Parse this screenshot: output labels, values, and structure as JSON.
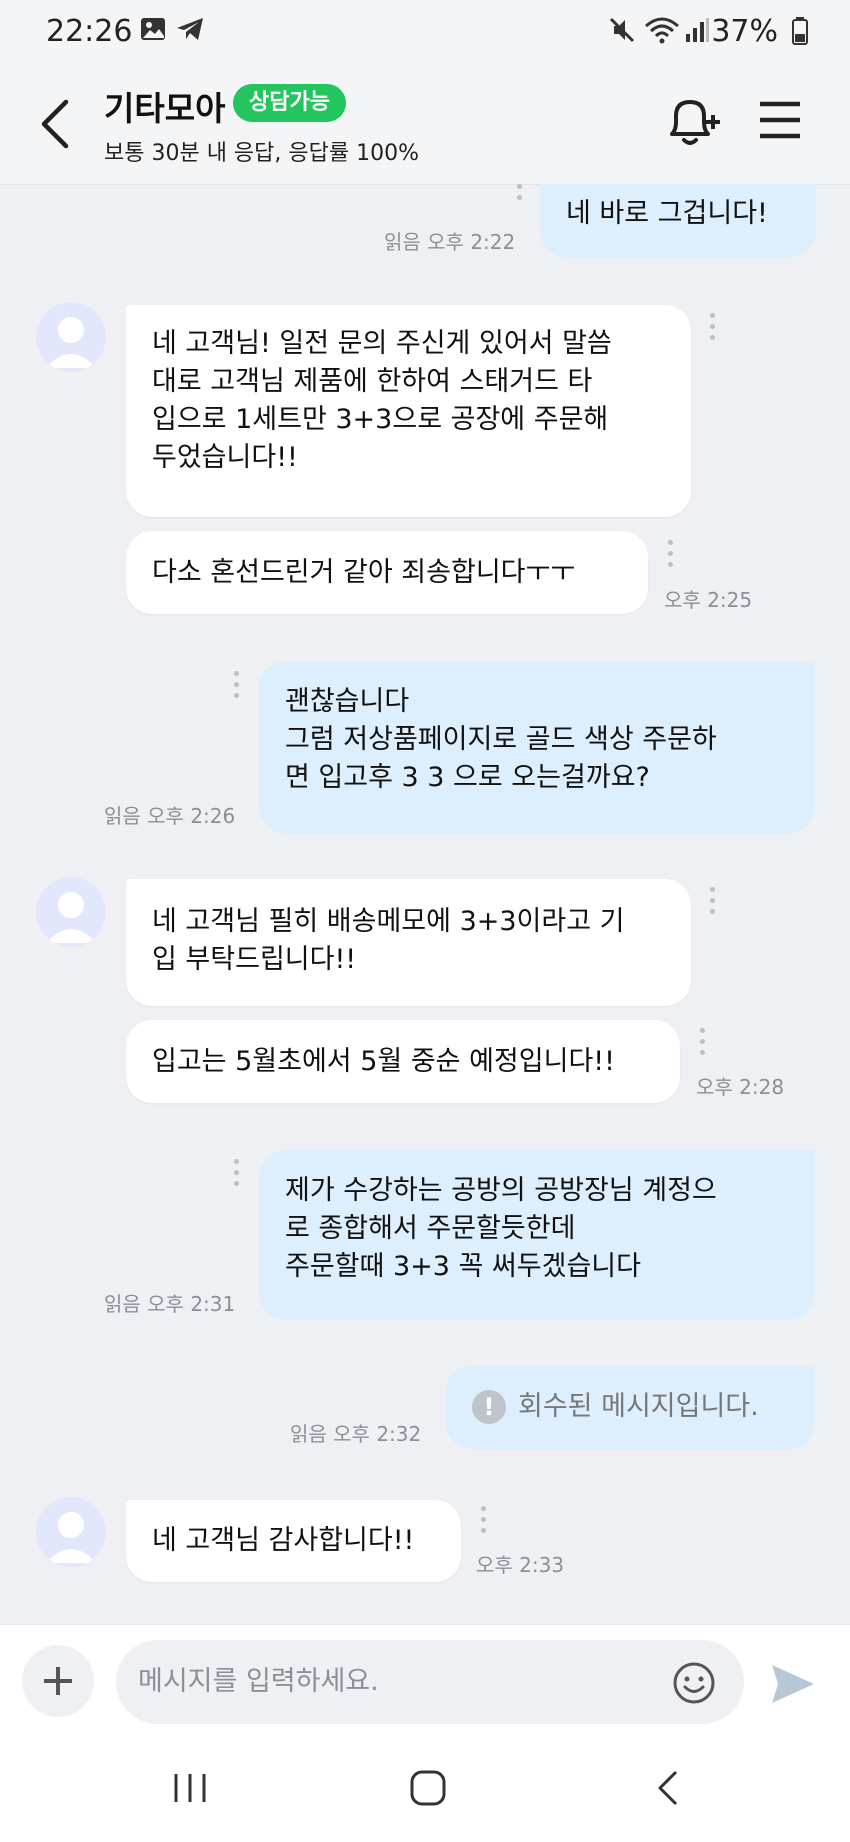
{
  "status_bar": {
    "time": "22:26",
    "battery": "37%",
    "icons": [
      "gallery-icon",
      "telegram-icon",
      "mute-icon",
      "wifi-icon",
      "signal-icon",
      "battery-icon"
    ]
  },
  "header": {
    "title": "기타모아",
    "badge": "상담가능",
    "subtitle": "보통 30분 내 응답, 응답률 100%",
    "badge_color": "#22c55e"
  },
  "messages": [
    {
      "dir": "out",
      "text": "네 바로 그겁니다!",
      "meta": "읽음 오후 2:22"
    },
    {
      "dir": "in",
      "text": "네 고객님! 일전 문의 주신게 있어서 말씀\n대로 고객님 제품에 한하여 스태거드 타\n입으로 1세트만 3+3으로 공장에 주문해\n두었습니다!!",
      "meta": ""
    },
    {
      "dir": "in",
      "text": "다소 혼선드린거 같아 죄송합니다ㅜㅜ",
      "meta": "오후 2:25"
    },
    {
      "dir": "out",
      "text": "괜찮습니다\n그럼 저상품페이지로 골드 색상 주문하\n면 입고후 3 3 으로 오는걸까요?",
      "meta": "읽음 오후 2:26"
    },
    {
      "dir": "in",
      "text": "네 고객님 필히 배송메모에 3+3이라고 기\n입 부탁드립니다!!",
      "meta": ""
    },
    {
      "dir": "in",
      "text": "입고는 5월초에서 5월 중순 예정입니다!!",
      "meta": "오후 2:28"
    },
    {
      "dir": "out",
      "text": "제가 수강하는 공방의 공방장님 계정으\n로 종합해서 주문할듯한데\n주문할때 3+3 꼭 써두겠습니다",
      "meta": "읽음 오후 2:31"
    },
    {
      "dir": "out",
      "text": "회수된 메시지입니다.",
      "meta": "읽음 오후 2:32"
    },
    {
      "dir": "in",
      "text": "네 고객님 감사합니다!!",
      "meta": "오후 2:33"
    }
  ],
  "input": {
    "placeholder": "메시지를 입력하세요."
  },
  "colors": {
    "background": "#eef0f3",
    "outgoing_bubble": "#ddeefc",
    "incoming_bubble": "#ffffff",
    "avatar": "#e3e7fb"
  }
}
